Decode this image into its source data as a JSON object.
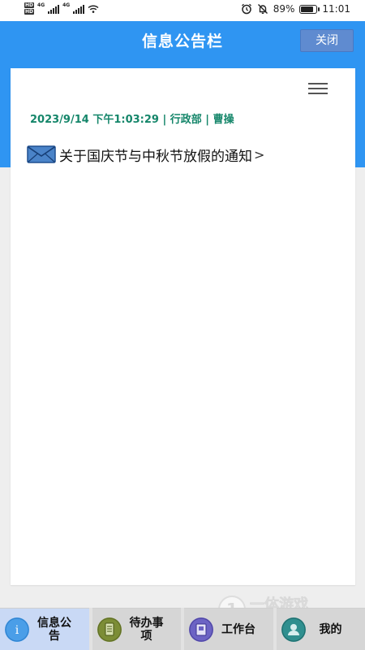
{
  "status_bar": {
    "hd_badges": [
      "HD",
      "HD"
    ],
    "signal_labels": [
      "4G",
      "4G"
    ],
    "battery_percent": "89%",
    "battery_level": 0.89,
    "time": "11:01"
  },
  "header": {
    "title": "信息公告栏",
    "close_label": "关闭"
  },
  "notices": [
    {
      "meta": "2023/9/14 下午1:03:29 | 行政部 | 曹操",
      "title": "关于国庆节与中秋节放假的通知",
      "icon": "envelope-icon"
    }
  ],
  "bottom_nav": [
    {
      "label": "信息公告",
      "icon": "info-icon",
      "active": true
    },
    {
      "label": "待办事项",
      "icon": "clipboard-icon",
      "active": false
    },
    {
      "label": "工作台",
      "icon": "workbench-icon",
      "active": false
    },
    {
      "label": "我的",
      "icon": "user-icon",
      "active": false
    }
  ],
  "watermark": {
    "text": "一体游戏",
    "subtext": "XUI.COM"
  },
  "colors": {
    "header_blue": "#2f95f2",
    "meta_green": "#15866a",
    "close_button": "#5f8bd0"
  }
}
